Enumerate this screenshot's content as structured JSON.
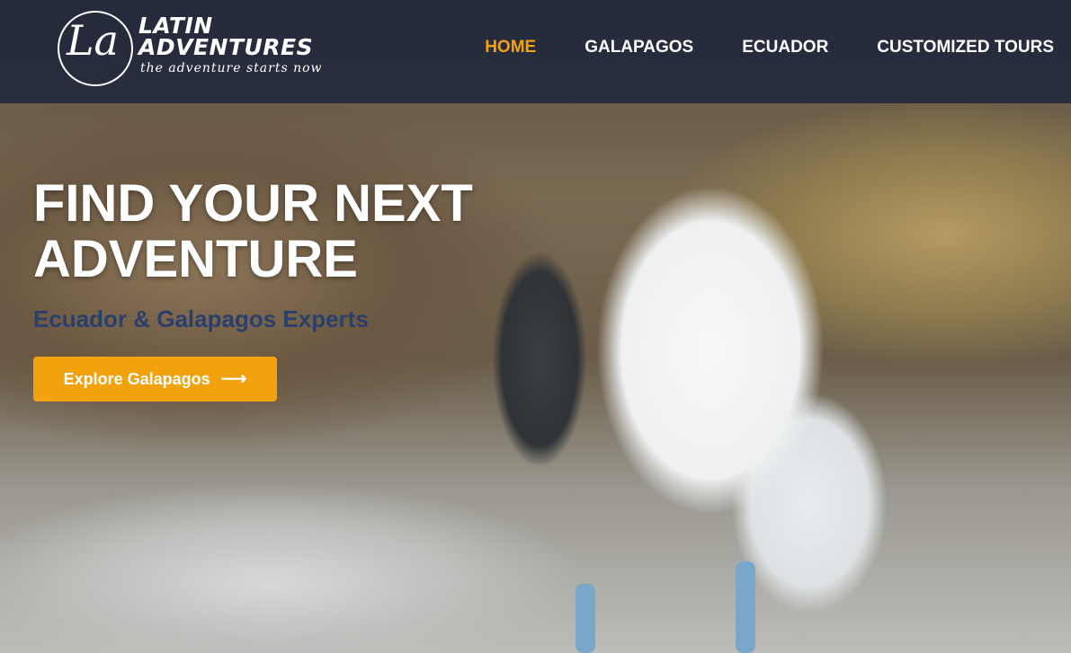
{
  "brand": {
    "monogram": "La",
    "name_line1": "LATIN",
    "name_line2": "ADVENTURES",
    "tagline": "the adventure starts now"
  },
  "nav": {
    "items": [
      {
        "label": "HOME",
        "active": true
      },
      {
        "label": "GALAPAGOS",
        "active": false
      },
      {
        "label": "ECUADOR",
        "active": false
      },
      {
        "label": "CUSTOMIZED TOURS",
        "active": false
      }
    ]
  },
  "hero": {
    "title_line1": "FIND YOUR NEXT",
    "title_line2": "ADVENTURE",
    "subtitle": "Ecuador & Galapagos Experts",
    "cta_label": "Explore Galapagos",
    "cta_icon": "arrow-right-icon",
    "background_image": "blue-footed booby with chick"
  },
  "colors": {
    "accent": "#f2a20c",
    "header_bg": "#16213c",
    "subtitle": "#2a3f6a",
    "text": "#ffffff"
  }
}
